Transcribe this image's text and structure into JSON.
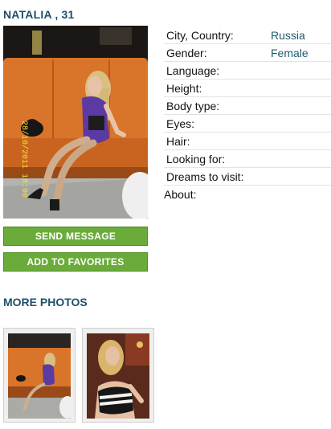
{
  "profile": {
    "title": "NATALIA , 31",
    "photo_stamp": "28/10/2011 18:00"
  },
  "actions": {
    "send_label": "SEND MESSAGE",
    "favorites_label": "ADD TO FAVORITES"
  },
  "details": [
    {
      "label": "City, Country:",
      "value": "Russia"
    },
    {
      "label": "Gender:",
      "value": "Female"
    },
    {
      "label": "Language:",
      "value": ""
    },
    {
      "label": "Height:",
      "value": ""
    },
    {
      "label": "Body type:",
      "value": ""
    },
    {
      "label": "Eyes:",
      "value": ""
    },
    {
      "label": "Hair:",
      "value": ""
    },
    {
      "label": "Looking for:",
      "value": ""
    },
    {
      "label": "Dreams to visit:",
      "value": ""
    }
  ],
  "about_label": "About:",
  "more_photos": {
    "heading": "MORE PHOTOS"
  },
  "colors": {
    "heading": "#1e4f6b",
    "value": "#1e5a6e",
    "button": "#6aab3a",
    "sofa": "#d9742b"
  }
}
